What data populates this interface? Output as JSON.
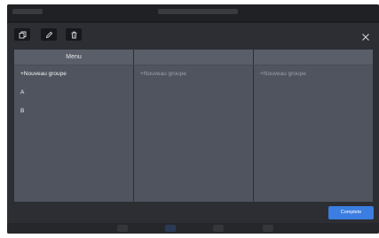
{
  "toolbar": {
    "icons": [
      "copy-icon",
      "edit-icon",
      "delete-icon"
    ],
    "close_icon": "close-icon"
  },
  "columns": [
    {
      "header": "Menu",
      "items": [
        {
          "label": "+Nouveau groupe",
          "state": "active"
        },
        {
          "label": "A",
          "state": "active"
        },
        {
          "label": "B",
          "state": "active"
        }
      ]
    },
    {
      "header": "",
      "items": [
        {
          "label": "+Nouveau groupe",
          "state": "placeholder"
        }
      ]
    },
    {
      "header": "",
      "items": [
        {
          "label": "+Nouveau groupe",
          "state": "placeholder"
        }
      ]
    }
  ],
  "footer": {
    "complete_label": "Complete"
  },
  "colors": {
    "accent": "#3b7de0",
    "modal_bg": "#2c2e33",
    "panel_bg": "#50545e",
    "header_bg": "#5a5e68"
  }
}
